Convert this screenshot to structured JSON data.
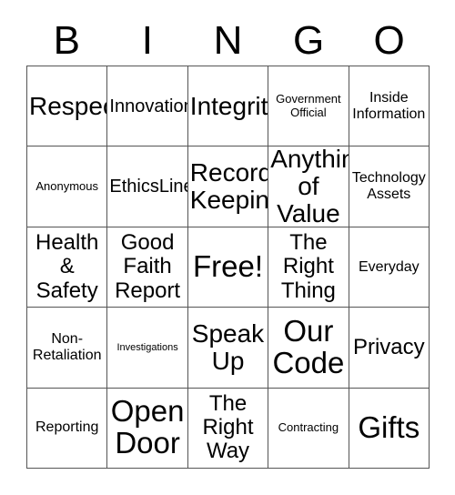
{
  "card": {
    "type": "bingo-card",
    "header_letters": [
      "B",
      "I",
      "N",
      "G",
      "O"
    ],
    "grid_size": "5x5",
    "background_color": "#ffffff",
    "text_color": "#000000",
    "grid_line_color": "#555555",
    "free_space": "Free!",
    "rows": [
      [
        {
          "text": "Respect",
          "size": "sz-2xl"
        },
        {
          "text": "Innovation",
          "size": "sz-lg"
        },
        {
          "text": "Integrity",
          "size": "sz-2xl"
        },
        {
          "text": "Government\nOfficial",
          "size": "sz-sm"
        },
        {
          "text": "Inside\nInformation",
          "size": "sz-md"
        }
      ],
      [
        {
          "text": "Anonymous",
          "size": "sz-sm"
        },
        {
          "text": "EthicsLine",
          "size": "sz-lg"
        },
        {
          "text": "Record-\nKeeping",
          "size": "sz-2xl"
        },
        {
          "text": "Anything\nof Value",
          "size": "sz-2xl"
        },
        {
          "text": "Technology\nAssets",
          "size": "sz-md"
        }
      ],
      [
        {
          "text": "Health\n&\nSafety",
          "size": "sz-xl"
        },
        {
          "text": "Good\nFaith\nReport",
          "size": "sz-xl"
        },
        {
          "text": "Free!",
          "size": "sz-3xl"
        },
        {
          "text": "The\nRight\nThing",
          "size": "sz-xl"
        },
        {
          "text": "Everyday",
          "size": "sz-md"
        }
      ],
      [
        {
          "text": "Non-\nRetaliation",
          "size": "sz-md"
        },
        {
          "text": "Investigations",
          "size": "sz-xs"
        },
        {
          "text": "Speak\nUp",
          "size": "sz-2xl"
        },
        {
          "text": "Our\nCode",
          "size": "sz-3xl"
        },
        {
          "text": "Privacy",
          "size": "sz-xl"
        }
      ],
      [
        {
          "text": "Reporting",
          "size": "sz-md"
        },
        {
          "text": "Open\nDoor",
          "size": "sz-3xl"
        },
        {
          "text": "The\nRight\nWay",
          "size": "sz-xl"
        },
        {
          "text": "Contracting",
          "size": "sz-sm"
        },
        {
          "text": "Gifts",
          "size": "sz-3xl"
        }
      ]
    ]
  }
}
